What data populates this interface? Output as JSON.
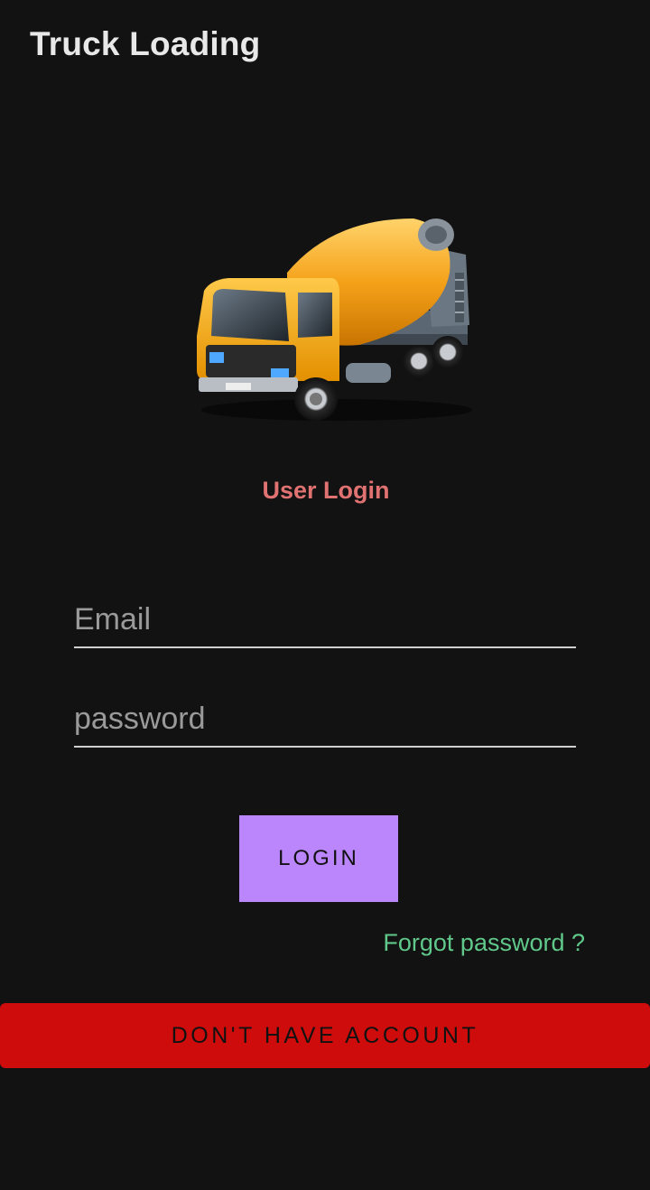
{
  "app_bar": {
    "title": "Truck Loading"
  },
  "hero": {
    "icon": "concrete-mixer-truck-icon"
  },
  "login_form": {
    "heading": "User Login",
    "email": {
      "value": "",
      "placeholder": "Email"
    },
    "password": {
      "value": "",
      "placeholder": "password"
    },
    "login_label": "LOGIN",
    "forgot_label": "Forgot password ?"
  },
  "footer": {
    "account_label": "DON'T HAVE ACCOUNT"
  },
  "colors": {
    "background": "#121212",
    "heading": "#e07272",
    "login_button": "#bb86fc",
    "forgot_link": "#5fc88a",
    "account_button": "#cf0c0c"
  }
}
